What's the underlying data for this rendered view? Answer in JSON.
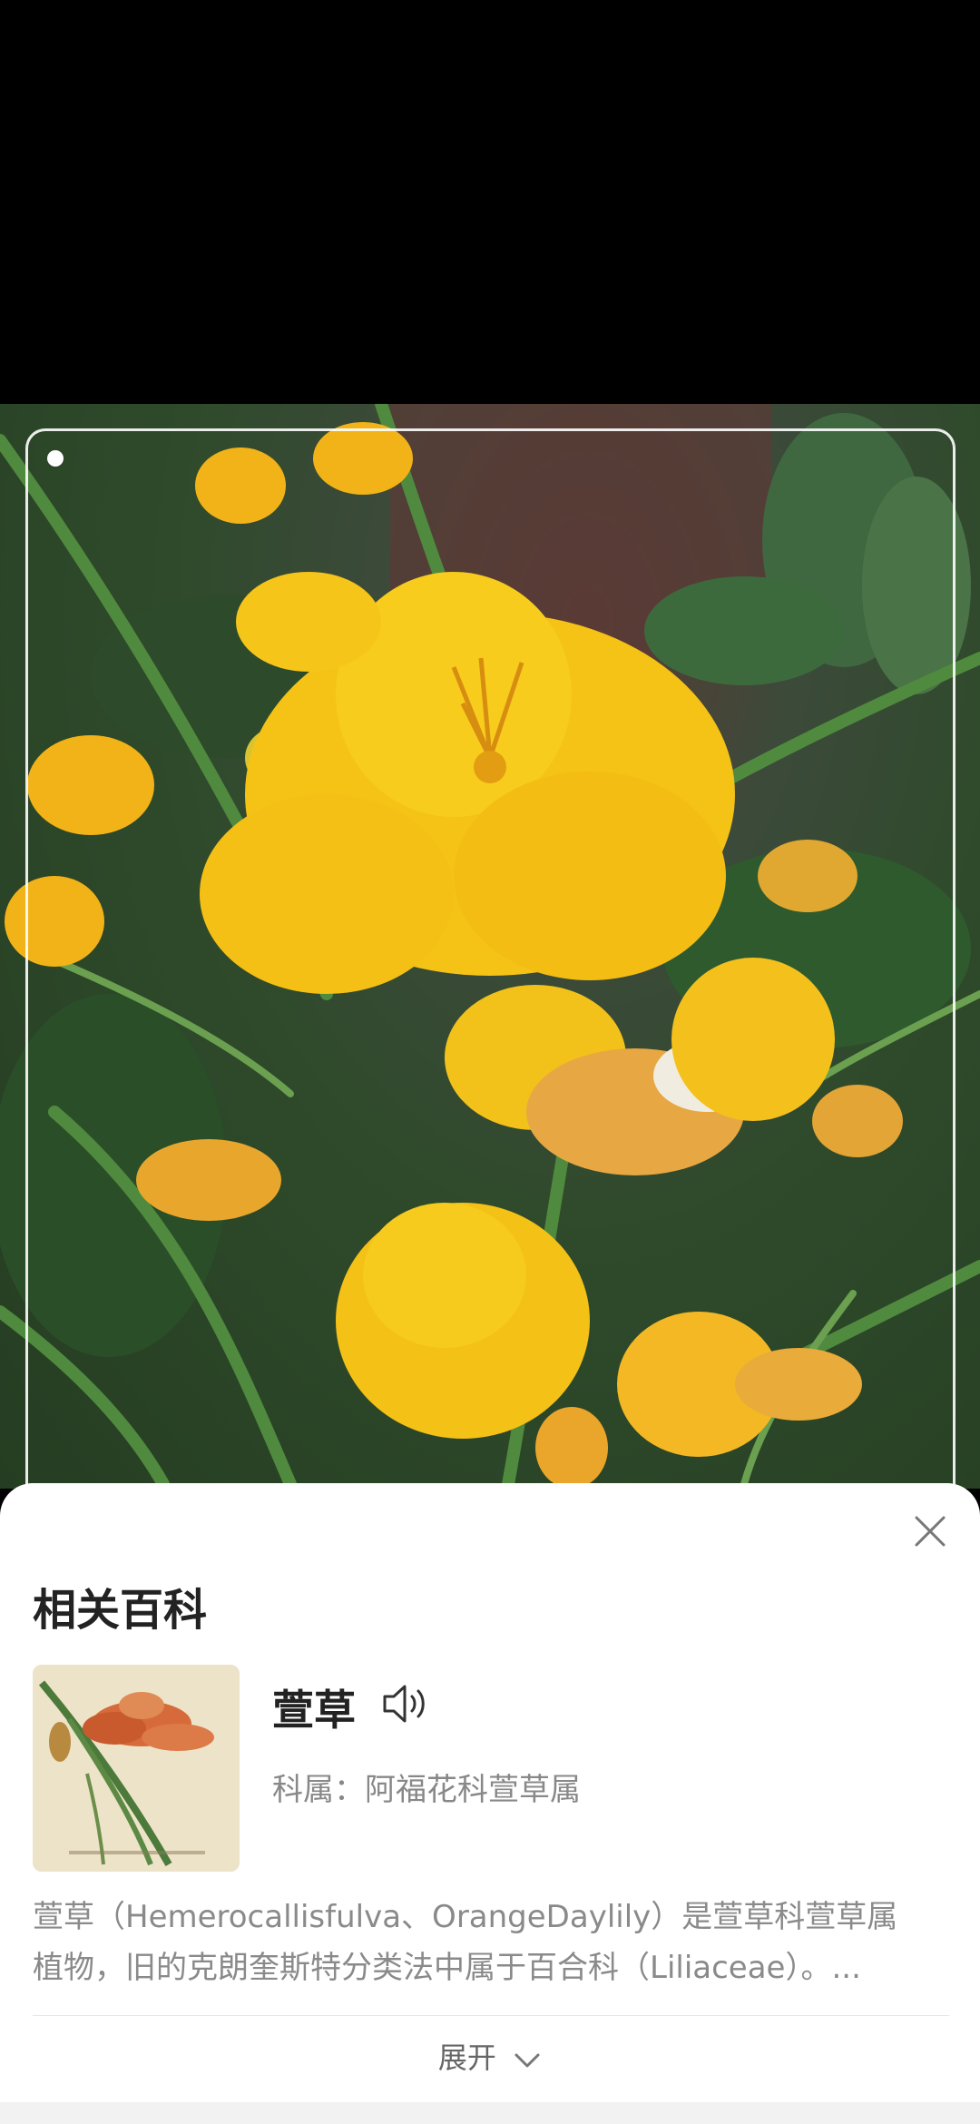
{
  "sheet": {
    "title": "相关百科",
    "entry": {
      "name": "萱草",
      "family_label": "科属：",
      "family_value": "阿福花科萱草属"
    },
    "description_line1": "萱草（Hemerocallisfulva、OrangeDaylily）是萱草科萱草属",
    "description_line2": "植物，旧的克朗奎斯特分类法中属于百合科（Liliaceae）。...",
    "expand_label": "展开"
  },
  "icons": {
    "close": "close-icon",
    "speaker": "speaker-icon",
    "expand": "chevron-down-icon"
  }
}
